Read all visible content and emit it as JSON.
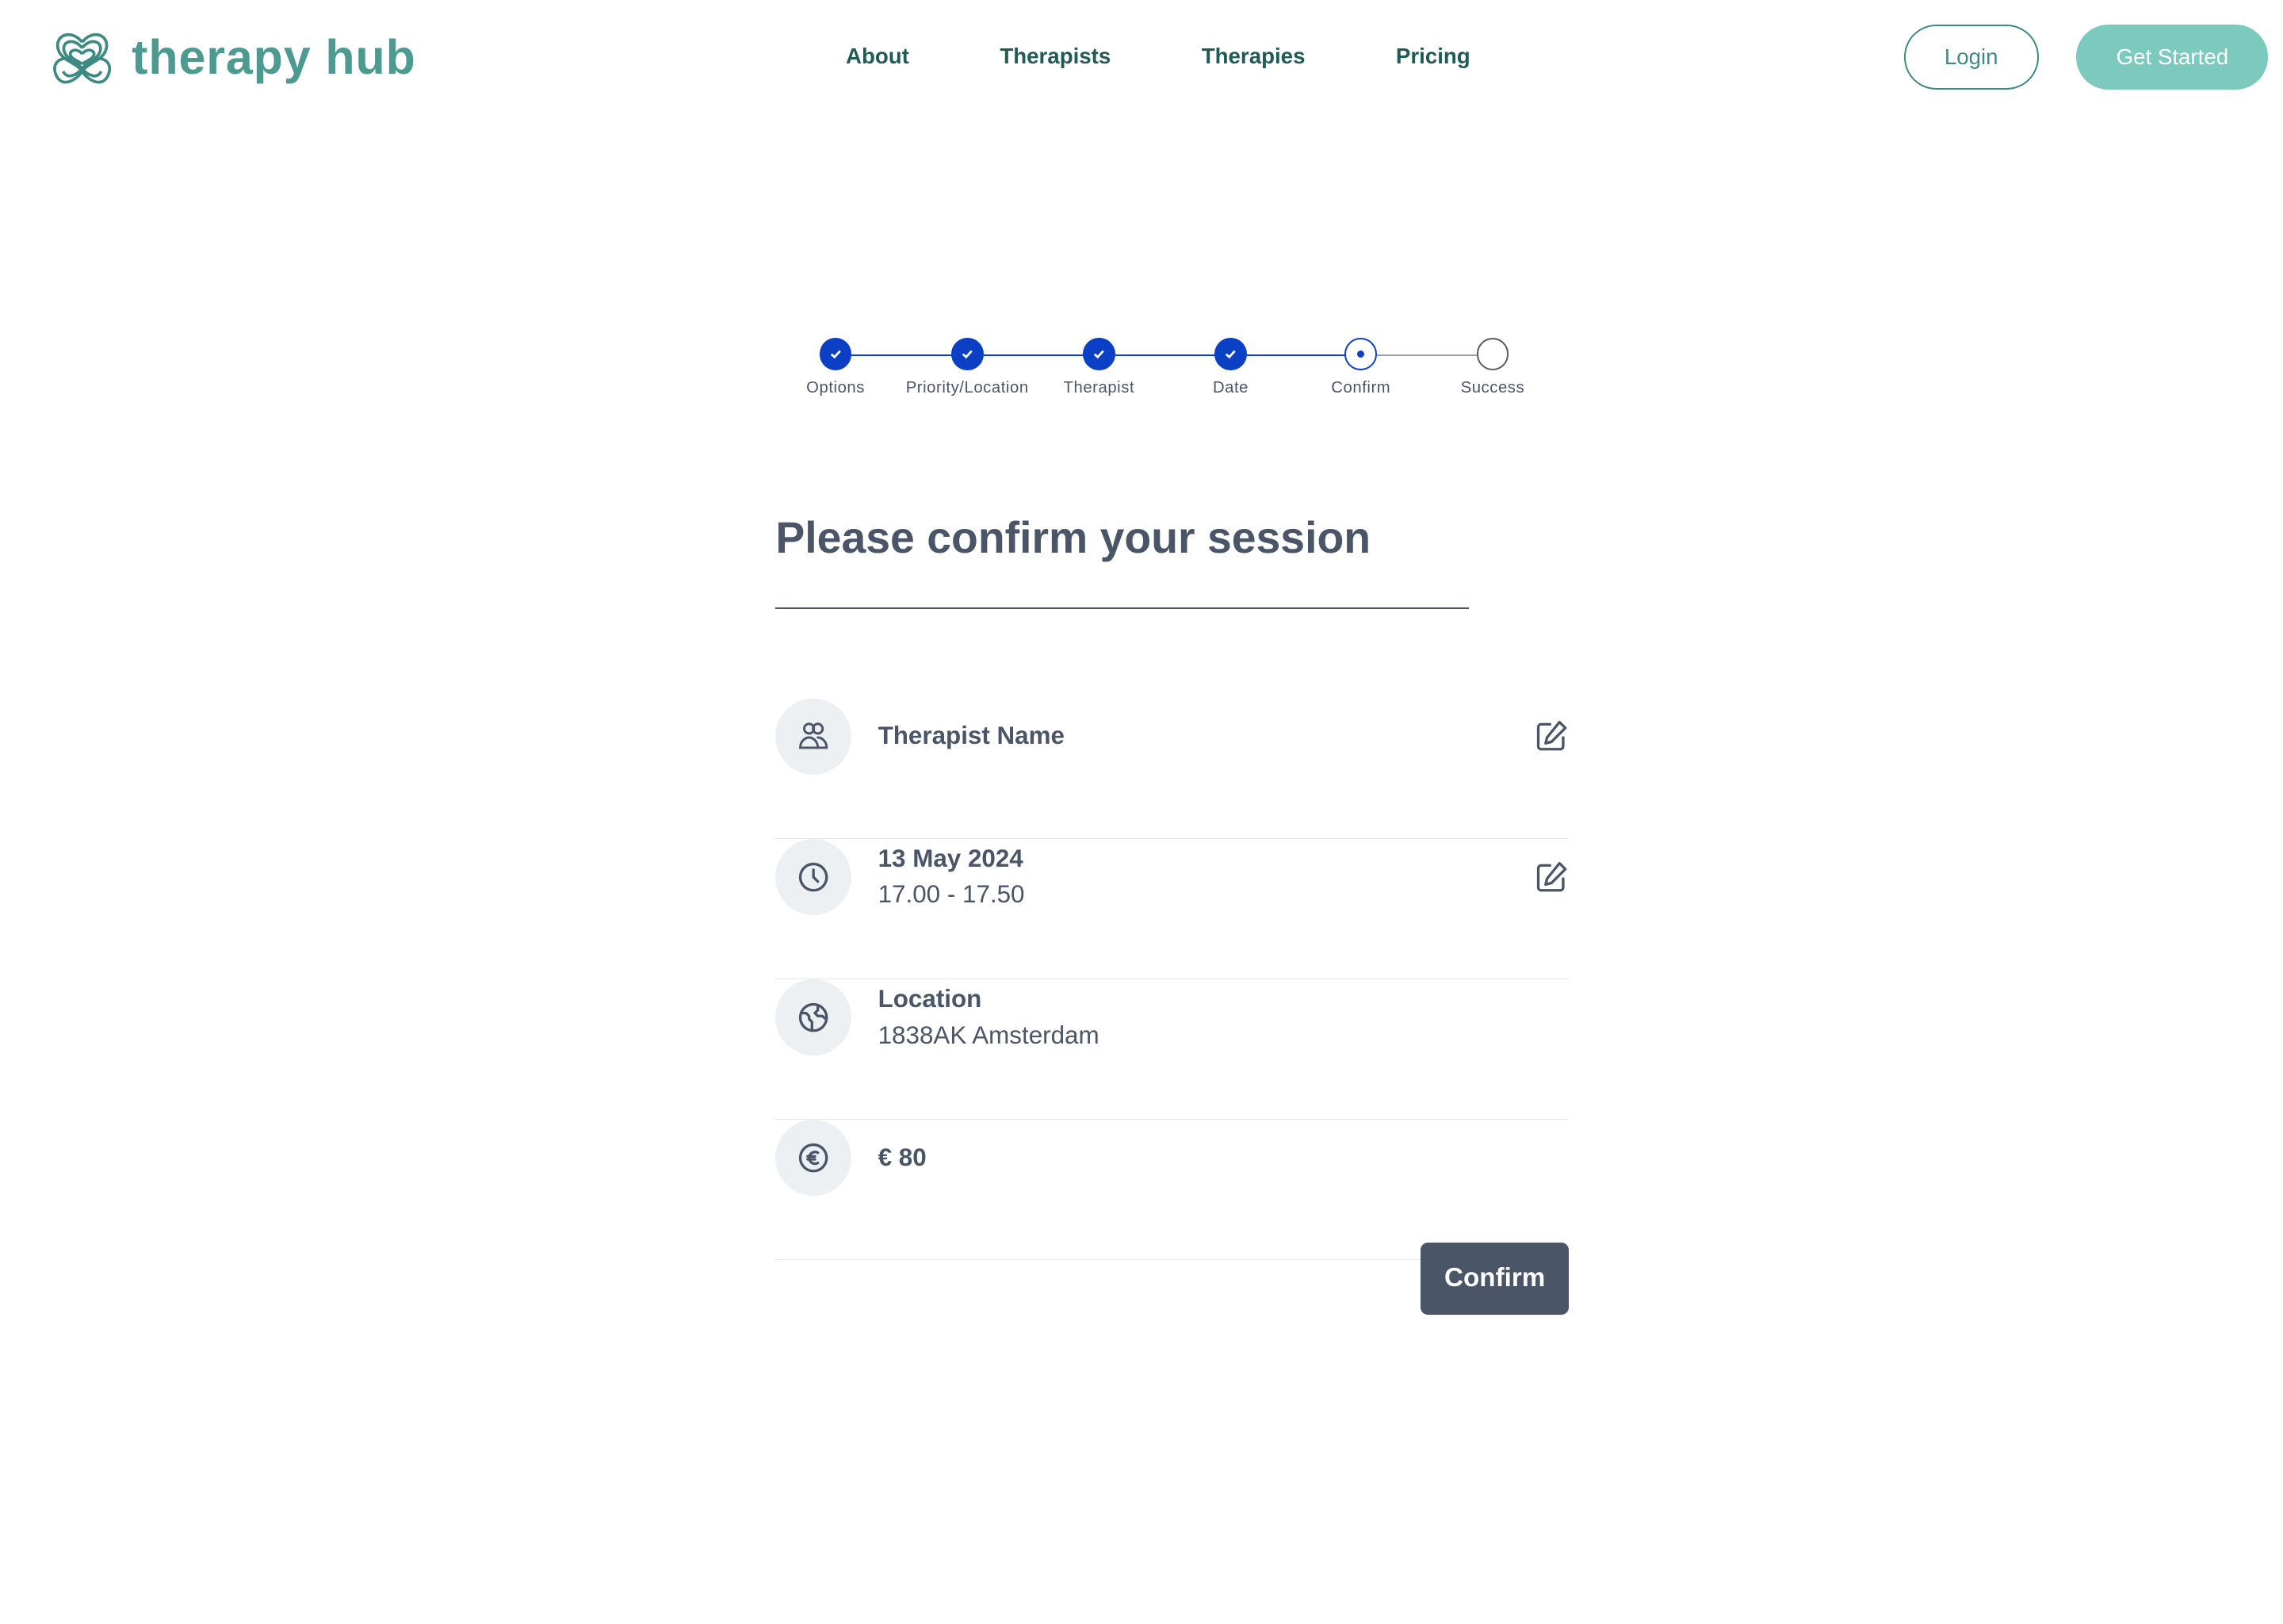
{
  "brand": {
    "name": "therapy hub",
    "color": "#4d9a91"
  },
  "nav": {
    "items": [
      {
        "label": "About"
      },
      {
        "label": "Therapists"
      },
      {
        "label": "Therapies"
      },
      {
        "label": "Pricing"
      }
    ]
  },
  "header": {
    "login_label": "Login",
    "get_started_label": "Get Started"
  },
  "stepper": {
    "steps": [
      {
        "label": "Options",
        "state": "done"
      },
      {
        "label": "Priority/Location",
        "state": "done"
      },
      {
        "label": "Therapist",
        "state": "done"
      },
      {
        "label": "Date",
        "state": "done"
      },
      {
        "label": "Confirm",
        "state": "current"
      },
      {
        "label": "Success",
        "state": "todo"
      }
    ],
    "active_color": "#0b3fc4"
  },
  "main": {
    "title": "Please confirm your session",
    "therapist": {
      "name": "Therapist Name",
      "icon": "users-icon"
    },
    "datetime": {
      "date": "13 May 2024",
      "time": "17.00 - 17.50",
      "icon": "clock-icon"
    },
    "location": {
      "label": "Location",
      "value": "1838AK Amsterdam",
      "icon": "globe-icon"
    },
    "price": {
      "value": "€ 80",
      "icon": "euro-icon"
    },
    "confirm_label": "Confirm"
  }
}
